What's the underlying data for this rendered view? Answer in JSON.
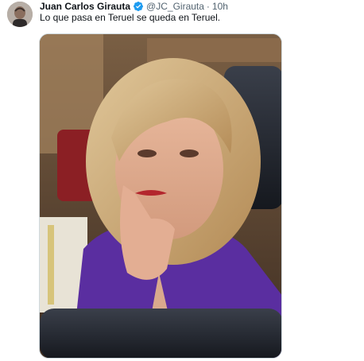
{
  "tweet": {
    "author_name": "Juan Carlos Girauta",
    "handle": "@JC_Girauta",
    "separator": "·",
    "timestamp": "10h",
    "text": "Lo que pasa en Teruel se queda en Teruel.",
    "verified_color": "#1d9bf0"
  },
  "colors": {
    "name": "#0f1419",
    "meta": "#536471",
    "border": "#cfd9de"
  }
}
